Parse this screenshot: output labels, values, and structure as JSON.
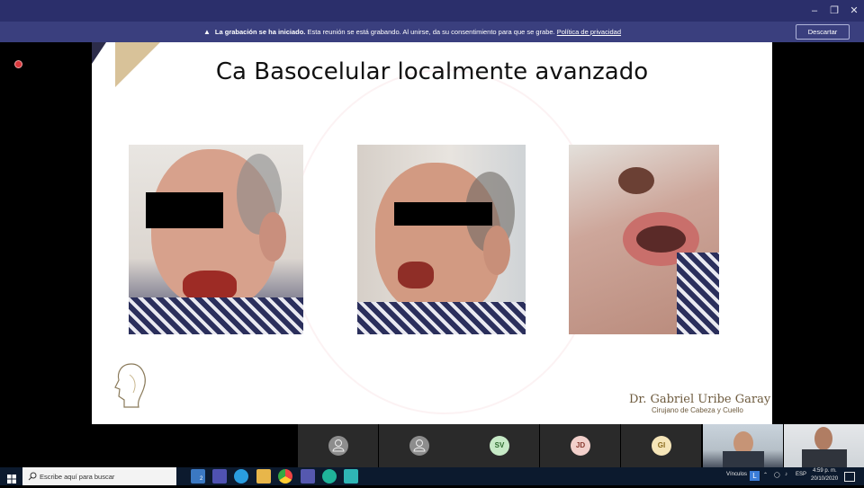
{
  "window": {
    "minimize_icon": "minimize-icon",
    "restore_icon": "restore-icon",
    "close_icon": "close-icon"
  },
  "banner": {
    "bold": "La grabación se ha iniciado.",
    "text": " Esta reunión se está grabando. Al unirse, da su consentimiento para que se grabe. ",
    "link": "Política de privacidad",
    "dismiss": "Descartar"
  },
  "slide": {
    "title": "Ca Basocelular localmente avanzado",
    "signature_name": "Dr. Gabriel Uribe Garay",
    "signature_subtitle": "Cirujano de Cabeza y Cuello"
  },
  "participants": [
    {
      "initials": "",
      "icon": "person-icon"
    },
    {
      "initials": "",
      "icon": "person-icon"
    },
    {
      "initials": "SV",
      "color": "#c6e9c6"
    },
    {
      "initials": "JD",
      "color": "#f2d0cb"
    },
    {
      "initials": "GI",
      "color": "#f5e5b8"
    }
  ],
  "taskbar": {
    "search_placeholder": "Escribe aquí para buscar",
    "badge": "2",
    "links_label": "Vínculos",
    "language": "ESP",
    "time": "4:59 p. m.",
    "date": "20/10/2020"
  }
}
